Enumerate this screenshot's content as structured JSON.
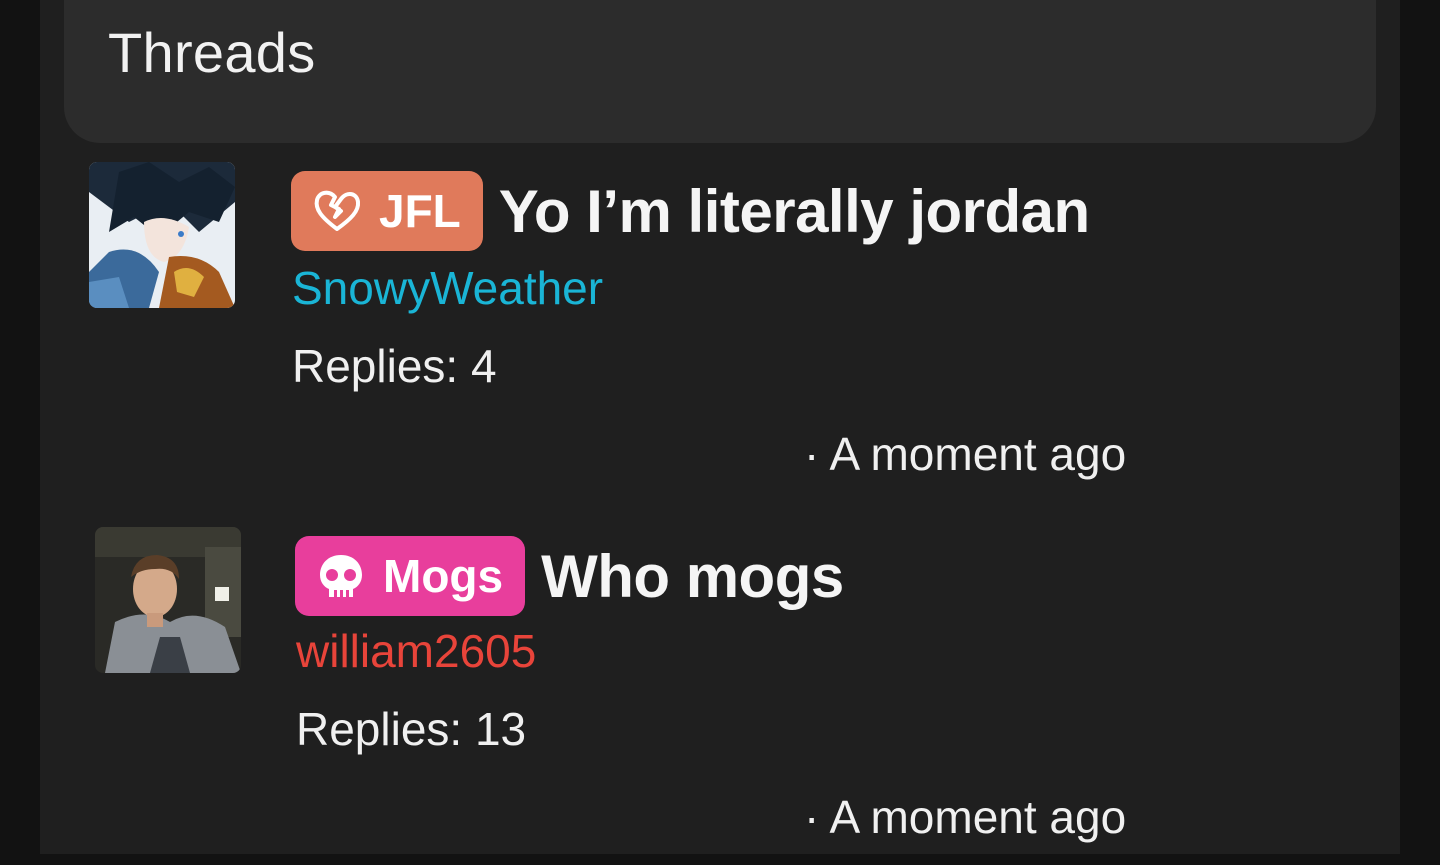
{
  "header": {
    "title": "Threads"
  },
  "threads": [
    {
      "tag": {
        "label": "JFL",
        "icon": "broken-heart-icon",
        "color": "#e07a5b"
      },
      "title": "Yo I’m literally jordan",
      "author": {
        "name": "SnowyWeather",
        "color": "#1ab5d6"
      },
      "replies_text": "Replies: 4",
      "timestamp": "· A moment ago",
      "avatar": "anime-character-avatar"
    },
    {
      "tag": {
        "label": "Mogs",
        "icon": "skull-icon",
        "color": "#e83e9c"
      },
      "title": "Who mogs",
      "author": {
        "name": "william2605",
        "color": "#e8443a"
      },
      "replies_text": "Replies: 13",
      "timestamp": "· A moment ago",
      "avatar": "user-photo-avatar"
    }
  ]
}
